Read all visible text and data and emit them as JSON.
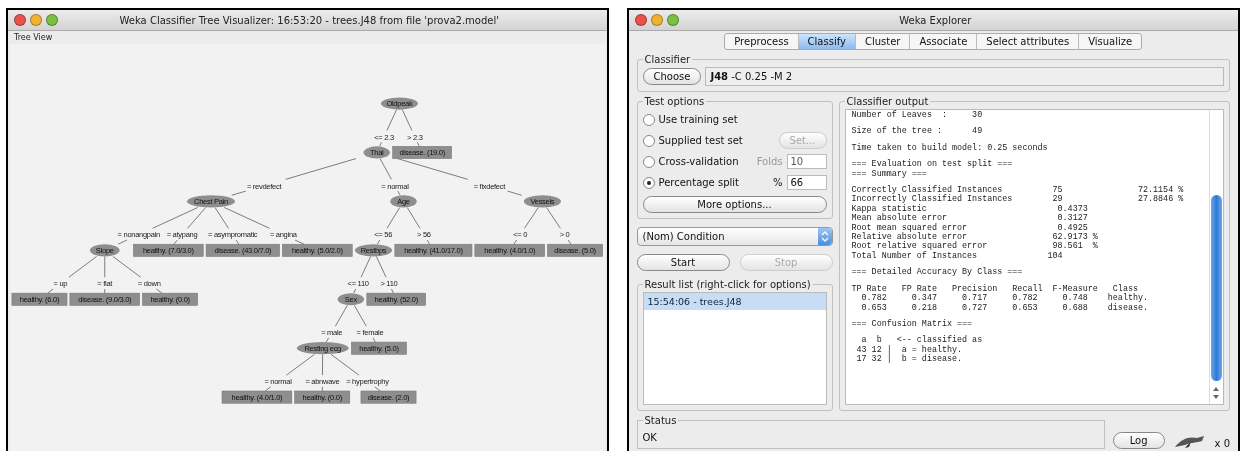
{
  "tree_window": {
    "title": "Weka Classifier Tree Visualizer: 16:53:20 - trees.J48 from file 'prova2.model'",
    "menu": "Tree View",
    "tree": {
      "label": "Oldpeak",
      "kind": "split",
      "children": [
        {
          "edge": "<= 2.3",
          "node": {
            "label": "Thal",
            "kind": "split",
            "children": [
              {
                "edge": "= revdefect",
                "node": {
                  "label": "Chest Pain",
                  "kind": "split",
                  "children": [
                    {
                      "edge": "= nonangpain",
                      "node": {
                        "label": "Slope",
                        "kind": "split",
                        "children": [
                          {
                            "edge": "= up",
                            "node": {
                              "label": "healthy. (6.0)",
                              "kind": "leaf"
                            }
                          },
                          {
                            "edge": "= flat",
                            "node": {
                              "label": "disease. (9.0/3.0)",
                              "kind": "leaf"
                            }
                          },
                          {
                            "edge": "= down",
                            "node": {
                              "label": "healthy. (0.0)",
                              "kind": "leaf"
                            }
                          }
                        ]
                      }
                    },
                    {
                      "edge": "= atypang",
                      "node": {
                        "label": "healthy. (7.0/3.0)",
                        "kind": "leaf"
                      }
                    },
                    {
                      "edge": "= asympromatic",
                      "node": {
                        "label": "disease. (43.0/7.0)",
                        "kind": "leaf"
                      }
                    },
                    {
                      "edge": "= angina",
                      "node": {
                        "label": "healthy. (5.0/2.0)",
                        "kind": "leaf"
                      }
                    }
                  ]
                }
              },
              {
                "edge": "= normal",
                "node": {
                  "label": "Age",
                  "kind": "split",
                  "children": [
                    {
                      "edge": "<= 56",
                      "node": {
                        "label": "Restbps",
                        "kind": "split",
                        "children": [
                          {
                            "edge": "<= 110",
                            "node": {
                              "label": "Sex",
                              "kind": "split",
                              "children": [
                                {
                                  "edge": "= male",
                                  "node": {
                                    "label": "Resting ecg",
                                    "kind": "split",
                                    "children": [
                                      {
                                        "edge": "= normal",
                                        "node": {
                                          "label": "healthy. (4.0/1.0)",
                                          "kind": "leaf"
                                        }
                                      },
                                      {
                                        "edge": "= abnwave",
                                        "node": {
                                          "label": "healthy. (0.0)",
                                          "kind": "leaf"
                                        }
                                      },
                                      {
                                        "edge": "= hypertrophy",
                                        "node": {
                                          "label": "disease. (2.0)",
                                          "kind": "leaf"
                                        }
                                      }
                                    ]
                                  }
                                },
                                {
                                  "edge": "= female",
                                  "node": {
                                    "label": "healthy. (5.0)",
                                    "kind": "leaf"
                                  }
                                }
                              ]
                            }
                          },
                          {
                            "edge": "> 110",
                            "node": {
                              "label": "healthy. (52.0)",
                              "kind": "leaf"
                            }
                          }
                        ]
                      }
                    },
                    {
                      "edge": "> 56",
                      "node": {
                        "label": "healthy. (41.0/17.0)",
                        "kind": "leaf"
                      }
                    }
                  ]
                }
              },
              {
                "edge": "= fixdefect",
                "node": {
                  "label": "Vessels",
                  "kind": "split",
                  "children": [
                    {
                      "edge": "<= 0",
                      "node": {
                        "label": "healthy. (4.0/1.0)",
                        "kind": "leaf"
                      }
                    },
                    {
                      "edge": "> 0",
                      "node": {
                        "label": "disease. (5.0)",
                        "kind": "leaf"
                      }
                    }
                  ]
                }
              }
            ]
          }
        },
        {
          "edge": "> 2.3",
          "node": {
            "label": "disease. (19.0)",
            "kind": "leaf"
          }
        }
      ]
    }
  },
  "explorer": {
    "title": "Weka Explorer",
    "tabs": [
      {
        "label": "Preprocess",
        "selected": false
      },
      {
        "label": "Classify",
        "selected": true
      },
      {
        "label": "Cluster",
        "selected": false
      },
      {
        "label": "Associate",
        "selected": false
      },
      {
        "label": "Select attributes",
        "selected": false
      },
      {
        "label": "Visualize",
        "selected": false
      }
    ],
    "classifier": {
      "title": "Classifier",
      "button": "Choose",
      "value": "**J48** -C 0.25 -M 2"
    },
    "test_options": {
      "title": "Test options",
      "options": [
        {
          "label": "Use training set",
          "selected": false
        },
        {
          "label": "Supplied test set",
          "selected": false,
          "button": {
            "label": "Set...",
            "disabled": true
          }
        },
        {
          "label": "Cross-validation",
          "selected": false,
          "field": {
            "label": "Folds",
            "value": "10",
            "disabled": true
          }
        },
        {
          "label": "Percentage split",
          "selected": true,
          "field": {
            "label": "%",
            "value": "66",
            "disabled": false
          }
        }
      ],
      "more_button": "More options..."
    },
    "class_select": "(Nom) Condition",
    "buttons": [
      {
        "label": "Start",
        "disabled": false
      },
      {
        "label": "Stop",
        "disabled": true
      }
    ],
    "result_list": {
      "title": "Result list (right-click for options)",
      "items": [
        {
          "label": "15:54:06 - trees.J48",
          "selected": true
        }
      ]
    },
    "output": {
      "title": "Classifier output",
      "blocks": [
        [
          "Number of Leaves  :     30"
        ],
        [
          "Size of the tree :      49"
        ],
        [
          "Time taken to build model: 0.25 seconds"
        ],
        [
          "=== Evaluation on test split ===",
          "=== Summary ==="
        ],
        [
          "Correctly Classified Instances          75               72.1154 %",
          "Incorrectly Classified Instances        29               27.8846 %",
          "Kappa statistic                          0.4373",
          "Mean absolute error                      0.3127",
          "Root mean squared error                  0.4925",
          "Relative absolute error                 62.9173 %",
          "Root relative squared error             98.561  %",
          "Total Number of Instances              104"
        ],
        [
          "=== Detailed Accuracy By Class ==="
        ],
        [
          "TP Rate   FP Rate   Precision   Recall  F-Measure   Class",
          "  0.782     0.347     0.717     0.782     0.748    healthy.",
          "  0.653     0.218     0.727     0.653     0.688    disease."
        ],
        [
          "=== Confusion Matrix ==="
        ],
        [
          "  a  b   <-- classified as",
          " 43 12 |  a = healthy.",
          " 17 32 |  b = disease."
        ]
      ]
    },
    "status": {
      "title": "Status",
      "text": "OK"
    },
    "log_button": "Log",
    "task_count": "x 0"
  }
}
